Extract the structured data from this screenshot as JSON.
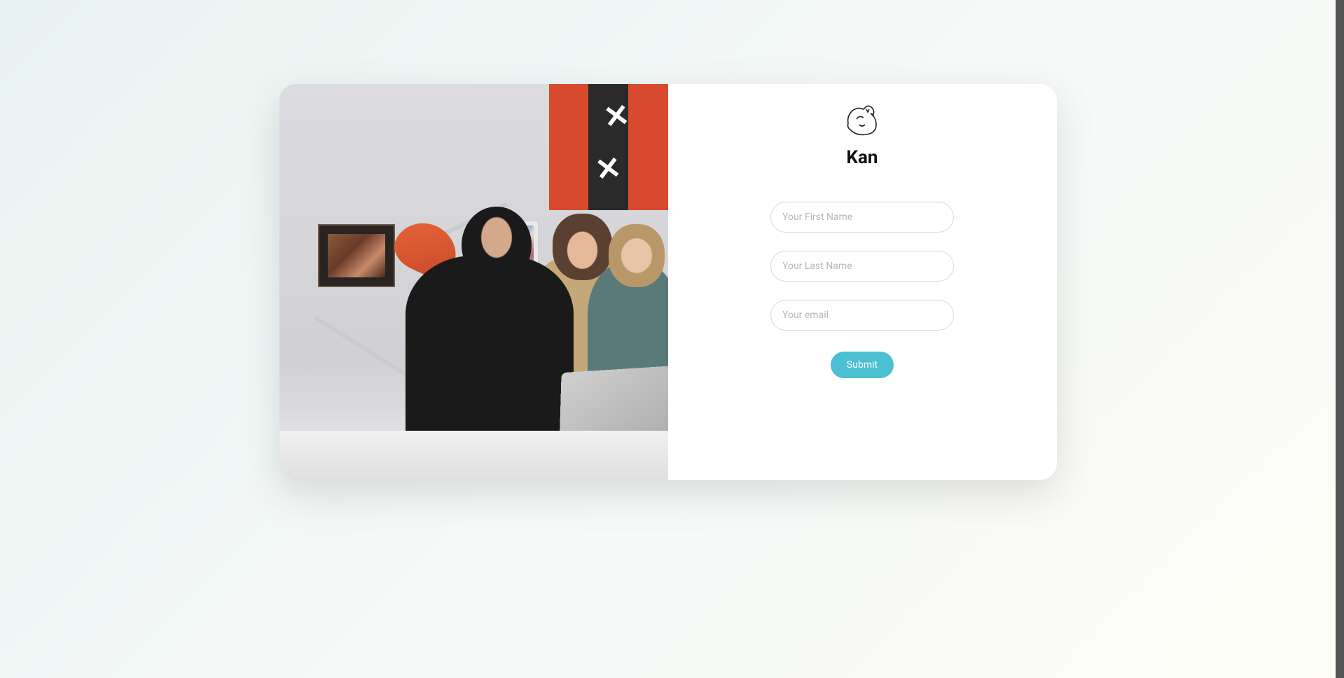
{
  "brand": {
    "name": "Kan"
  },
  "form": {
    "first_name": {
      "placeholder": "Your First Name",
      "value": ""
    },
    "last_name": {
      "placeholder": "Your Last Name",
      "value": ""
    },
    "email": {
      "placeholder": "Your email",
      "value": ""
    },
    "submit_label": "Submit"
  }
}
